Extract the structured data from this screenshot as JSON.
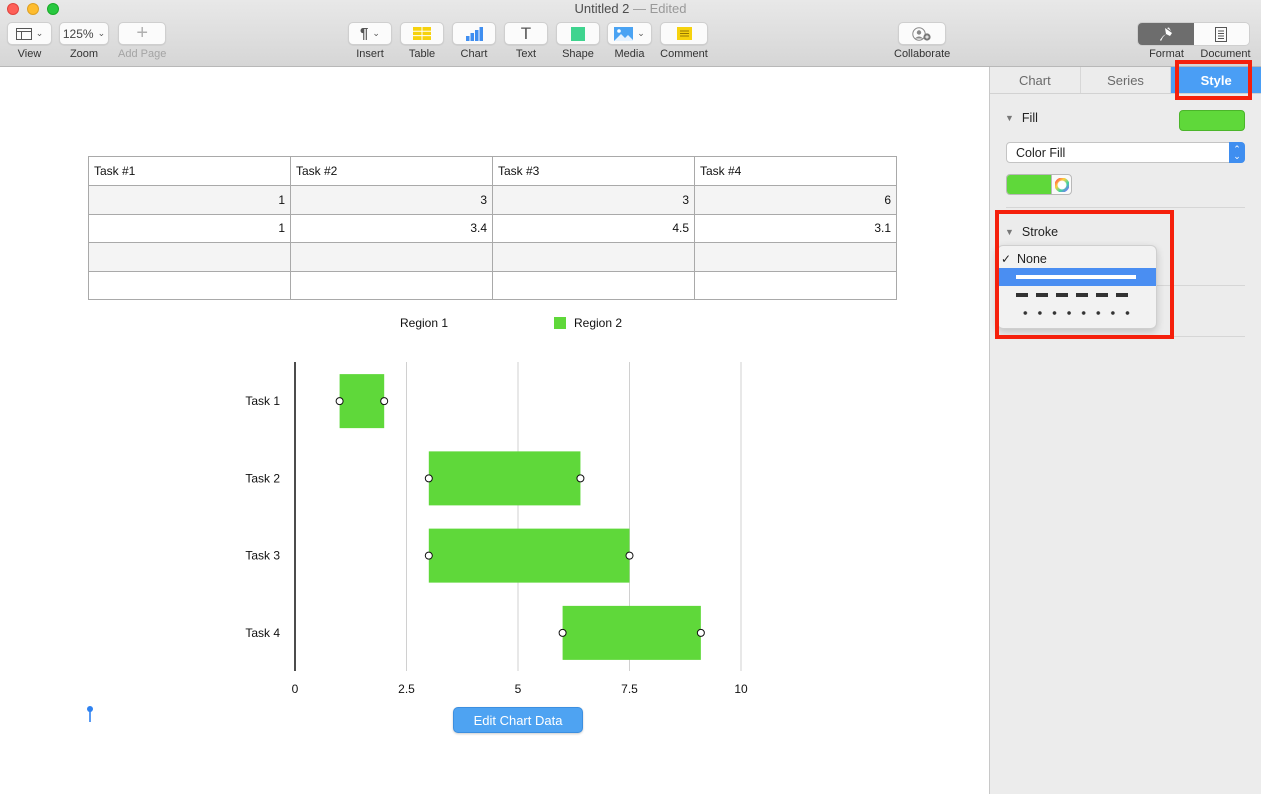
{
  "window": {
    "title": "Untitled 2",
    "title_separator": "—",
    "status": "Edited"
  },
  "toolbar": {
    "view": {
      "label": "View",
      "icon": "sidebar-layout-icon"
    },
    "zoom": {
      "label": "Zoom",
      "value": "125%"
    },
    "add_page": {
      "label": "Add Page",
      "icon": "plus-icon"
    },
    "insert": {
      "label": "Insert",
      "glyph": "¶",
      "icon": "pilcrow-icon"
    },
    "table": {
      "label": "Table",
      "icon": "table-icon"
    },
    "chart": {
      "label": "Chart",
      "icon": "bar-chart-icon"
    },
    "text": {
      "label": "Text",
      "glyph": "T",
      "icon": "text-icon"
    },
    "shape": {
      "label": "Shape",
      "icon": "shape-square-icon"
    },
    "media": {
      "label": "Media",
      "icon": "image-icon"
    },
    "comment": {
      "label": "Comment",
      "icon": "comment-note-icon"
    },
    "collaborate": {
      "label": "Collaborate",
      "icon": "add-person-icon"
    },
    "format": {
      "label": "Format",
      "icon": "paintbrush-icon",
      "active": true
    },
    "document": {
      "label": "Document",
      "icon": "document-icon"
    }
  },
  "table": {
    "headers": [
      "Task #1",
      "Task #2",
      "Task #3",
      "Task #4"
    ],
    "rows": [
      [
        "1",
        "3",
        "3",
        "6"
      ],
      [
        "1",
        "3.4",
        "4.5",
        "3.1"
      ],
      [
        "",
        "",
        "",
        ""
      ],
      [
        "",
        "",
        "",
        ""
      ]
    ]
  },
  "chart_data": {
    "type": "bar",
    "orientation": "horizontal",
    "stacked": true,
    "categories": [
      "Task 1",
      "Task 2",
      "Task 3",
      "Task 4"
    ],
    "series": [
      {
        "name": "Region 1",
        "values": [
          1,
          3,
          3,
          6
        ],
        "fill": "none"
      },
      {
        "name": "Region 2",
        "values": [
          1,
          3.4,
          4.5,
          3.1
        ],
        "fill": "#5fd83a"
      }
    ],
    "x_ticks": [
      "0",
      "2.5",
      "5",
      "7.5",
      "10"
    ],
    "x_tick_values": [
      0,
      2.5,
      5,
      7.5,
      10
    ],
    "xlim": [
      0,
      10
    ],
    "title": "",
    "xlabel": "",
    "ylabel": "",
    "grid": true,
    "legend_position": "top",
    "selected_series": "Region 2"
  },
  "canvas": {
    "edit_chart_button": "Edit Chart Data"
  },
  "sidebar": {
    "tabs": [
      {
        "label": "Chart",
        "active": false
      },
      {
        "label": "Series",
        "active": false
      },
      {
        "label": "Style",
        "active": true
      }
    ],
    "fill": {
      "title": "Fill",
      "color": "#5fd83a",
      "type": "Color Fill"
    },
    "stroke": {
      "title": "Stroke",
      "menu": [
        {
          "label": "None",
          "checked": true,
          "kind": "none"
        },
        {
          "label": "",
          "checked": false,
          "kind": "solid",
          "highlighted": true
        },
        {
          "label": "",
          "checked": false,
          "kind": "dashed"
        },
        {
          "label": "",
          "checked": false,
          "kind": "dotted"
        }
      ]
    }
  },
  "colors": {
    "accent": "#4a9ef5",
    "series_fill": "#5fd83a",
    "annotation": "#f5200c"
  }
}
